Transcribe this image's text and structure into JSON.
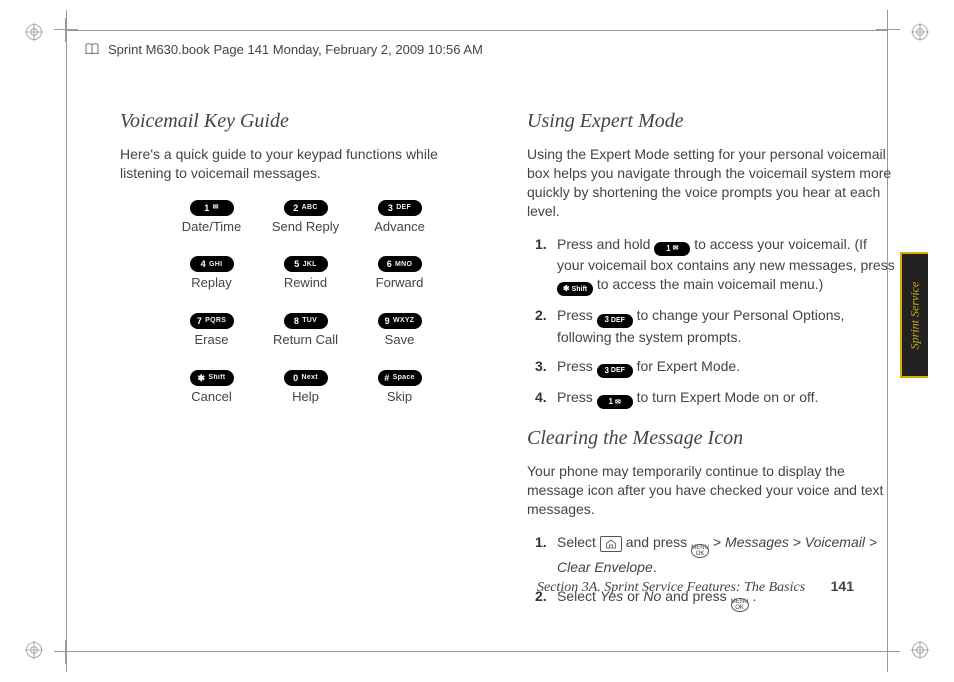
{
  "header": {
    "text": "Sprint M630.book  Page 141  Monday, February 2, 2009  10:56 AM"
  },
  "left": {
    "title": "Voicemail Key Guide",
    "intro": "Here's a quick guide to your keypad functions while listening to voicemail messages.",
    "keys": [
      {
        "chip_main": "1",
        "chip_sub": "✉",
        "label": "Date/Time"
      },
      {
        "chip_main": "2",
        "chip_sub": "ABC",
        "label": "Send Reply"
      },
      {
        "chip_main": "3",
        "chip_sub": "DEF",
        "label": "Advance"
      },
      {
        "chip_main": "4",
        "chip_sub": "GHI",
        "label": "Replay"
      },
      {
        "chip_main": "5",
        "chip_sub": "JKL",
        "label": "Rewind"
      },
      {
        "chip_main": "6",
        "chip_sub": "MNO",
        "label": "Forward"
      },
      {
        "chip_main": "7",
        "chip_sub": "PQRS",
        "label": "Erase"
      },
      {
        "chip_main": "8",
        "chip_sub": "TUV",
        "label": "Return Call"
      },
      {
        "chip_main": "9",
        "chip_sub": "WXYZ",
        "label": "Save"
      },
      {
        "chip_main": "✱",
        "chip_sub": "Shift",
        "label": "Cancel"
      },
      {
        "chip_main": "0",
        "chip_sub": "Next",
        "label": "Help"
      },
      {
        "chip_main": "#",
        "chip_sub": "Space",
        "label": "Skip"
      }
    ]
  },
  "right": {
    "expert": {
      "title": "Using Expert Mode",
      "intro": "Using the Expert Mode setting for your personal voicemail box helps you navigate through the voicemail system more quickly by shortening the voice prompts you hear at each level.",
      "steps": {
        "s1a": "Press and hold ",
        "s1b": " to access your voicemail. (If your voicemail box contains any new messages, press ",
        "s1c": " to access the main voicemail menu.)",
        "s2a": "Press ",
        "s2b": " to change your Personal Options, following the system prompts.",
        "s3a": "Press ",
        "s3b": " for Expert Mode.",
        "s4a": "Press ",
        "s4b": " to turn Expert Mode on or off."
      },
      "chips": {
        "one_main": "1",
        "one_sub": "✉",
        "star_main": "✱",
        "star_sub": "Shift",
        "three_main": "3",
        "three_sub": "DEF"
      }
    },
    "clear": {
      "title": "Clearing the Message Icon",
      "intro": "Your phone may temporarily continue to display the message icon after you have checked your voice and text messages.",
      "steps": {
        "s1a": "Select ",
        "s1b": " and press ",
        "s1c": " > ",
        "s1_path": "Messages > Voicemail > Clear Envelope",
        "s1d": ".",
        "s2a": "Select ",
        "s2_yes": "Yes",
        "s2_or": " or ",
        "s2_no": "No",
        "s2b": " and press ",
        "s2c": "."
      },
      "menu_label": "MENU OK"
    }
  },
  "footer": {
    "section": "Section 3A. Sprint Service Features: The Basics",
    "page": "141"
  },
  "sidetab": "Sprint Service"
}
